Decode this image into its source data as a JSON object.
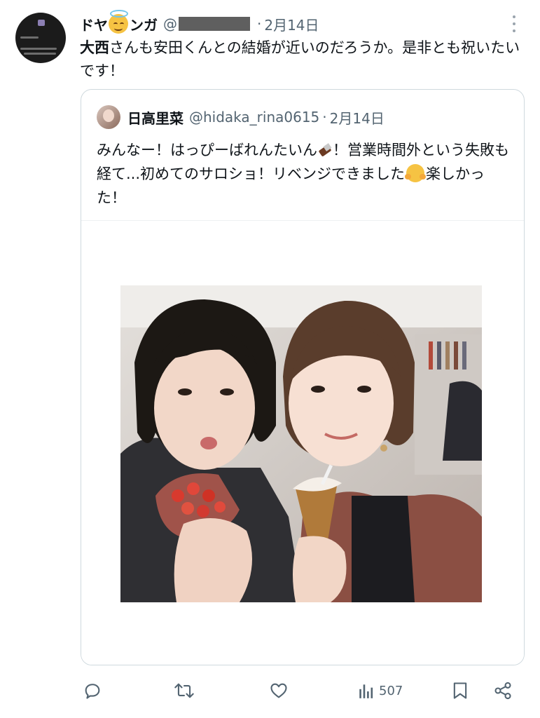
{
  "tweet": {
    "display_name": "ドヤ  ンガ",
    "name_part_1": "ドヤ",
    "name_part_2": "ンガ",
    "name_emoji": "smiling-face-with-halo-icon",
    "handle_prefix": "@",
    "separator": "·",
    "date": "2月14日",
    "text_bold": "大西",
    "text_rest": "さんも安田くんとの結婚が近いのだろうか。是非とも祝いたいです！"
  },
  "quote": {
    "display_name": "日高里菜",
    "handle": "@hidaka_rina0615",
    "separator": "·",
    "date": "2月14日",
    "text_1": "みんなー！はっぴーばれんたいん",
    "text_2": "！営業時間外という失敗も経て...初めてのサロショ！リベンジできました",
    "text_3": "楽しかった！",
    "emoji_1": "chocolate-bar-icon",
    "emoji_2": "hugging-face-icon"
  },
  "actions": {
    "reply_icon": "reply-icon",
    "retweet_icon": "retweet-icon",
    "like_icon": "heart-icon",
    "views_icon": "views-icon",
    "views_count": "507",
    "bookmark_icon": "bookmark-icon",
    "share_icon": "share-icon"
  },
  "colors": {
    "text": "#0f1419",
    "secondary": "#536471",
    "border": "#cfd9de"
  }
}
